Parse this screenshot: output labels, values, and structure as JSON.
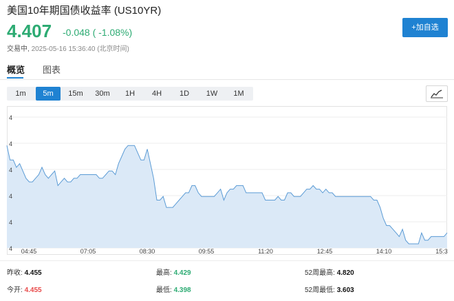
{
  "header": {
    "title": "美国10年期国债收益率 (US10YR)",
    "price": "4.407",
    "change": "-0.048 ( -1.08%)",
    "status": "交易中,",
    "timestamp": "2025-05-16 15:36:40 (北京时间)",
    "add_button": "+加自选"
  },
  "tabs": [
    {
      "label": "概览",
      "active": true
    },
    {
      "label": "图表",
      "active": false
    }
  ],
  "periods": [
    {
      "label": "1m",
      "active": false
    },
    {
      "label": "5m",
      "active": true
    },
    {
      "label": "15m",
      "active": false
    },
    {
      "label": "30m",
      "active": false
    },
    {
      "label": "1H",
      "active": false
    },
    {
      "label": "4H",
      "active": false
    },
    {
      "label": "1D",
      "active": false
    },
    {
      "label": "1W",
      "active": false
    },
    {
      "label": "1M",
      "active": false
    }
  ],
  "chart_type_icon": "line-chart-icon",
  "colors": {
    "up": "#2dab73",
    "down": "#e84a4a",
    "accent": "#1f82d2",
    "line": "#5b9bd5",
    "fill": "#dbe9f7"
  },
  "chart_data": {
    "type": "area",
    "x_tick_labels": [
      "04:45",
      "07:05",
      "08:30",
      "09:55",
      "11:20",
      "12:45",
      "14:10",
      "15:3"
    ],
    "y_tick_labels": [
      "4",
      "4",
      "4",
      "4",
      "4",
      "4"
    ],
    "ylim": [
      4.398,
      4.429
    ],
    "values": [
      4.425,
      4.421,
      4.421,
      4.419,
      4.42,
      4.418,
      4.416,
      4.415,
      4.415,
      4.416,
      4.417,
      4.419,
      4.417,
      4.416,
      4.417,
      4.418,
      4.414,
      4.415,
      4.416,
      4.415,
      4.415,
      4.416,
      4.416,
      4.417,
      4.417,
      4.417,
      4.417,
      4.417,
      4.417,
      4.416,
      4.416,
      4.417,
      4.418,
      4.418,
      4.417,
      4.42,
      4.422,
      4.424,
      4.425,
      4.425,
      4.425,
      4.423,
      4.421,
      4.421,
      4.424,
      4.42,
      4.416,
      4.41,
      4.41,
      4.411,
      4.408,
      4.408,
      4.408,
      4.409,
      4.41,
      4.411,
      4.412,
      4.412,
      4.414,
      4.414,
      4.412,
      4.411,
      4.411,
      4.411,
      4.411,
      4.411,
      4.412,
      4.413,
      4.41,
      4.412,
      4.413,
      4.413,
      4.414,
      4.414,
      4.414,
      4.412,
      4.412,
      4.412,
      4.412,
      4.412,
      4.412,
      4.41,
      4.41,
      4.41,
      4.41,
      4.411,
      4.41,
      4.41,
      4.412,
      4.412,
      4.411,
      4.411,
      4.411,
      4.412,
      4.413,
      4.413,
      4.414,
      4.413,
      4.413,
      4.412,
      4.413,
      4.412,
      4.412,
      4.411,
      4.411,
      4.411,
      4.411,
      4.411,
      4.411,
      4.411,
      4.411,
      4.411,
      4.411,
      4.411,
      4.411,
      4.41,
      4.41,
      4.408,
      4.405,
      4.403,
      4.403,
      4.402,
      4.401,
      4.4,
      4.402,
      4.399,
      4.398,
      4.398,
      4.398,
      4.398,
      4.401,
      4.399,
      4.399,
      4.4,
      4.4,
      4.4,
      4.4,
      4.4,
      4.401
    ]
  },
  "stats": [
    {
      "label": "昨收:",
      "value": "4.455",
      "tone": "black"
    },
    {
      "label": "最高:",
      "value": "4.429",
      "tone": "green"
    },
    {
      "label": "52周最高:",
      "value": "4.820",
      "tone": "black"
    },
    {
      "label": "今开:",
      "value": "4.455",
      "tone": "red"
    },
    {
      "label": "最低:",
      "value": "4.398",
      "tone": "green"
    },
    {
      "label": "52周最低:",
      "value": "3.603",
      "tone": "black"
    }
  ]
}
